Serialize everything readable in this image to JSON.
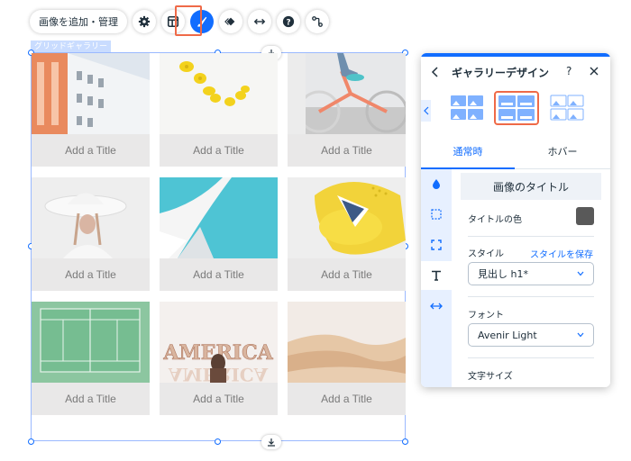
{
  "toolbar": {
    "add_manage_label": "画像を追加・管理",
    "icons": [
      "gear-icon",
      "layout-icon",
      "design-brush-icon",
      "animation-icon",
      "stretch-icon",
      "help-icon",
      "connect-icon"
    ]
  },
  "gallery": {
    "tag_label": "グリッドギャラリー",
    "items": [
      {
        "title": "Add a Title",
        "image": "white-building-facade"
      },
      {
        "title": "Add a Title",
        "image": "lemons-on-white"
      },
      {
        "title": "Add a Title",
        "image": "bicycle-sneakers"
      },
      {
        "title": "Add a Title",
        "image": "woman-in-white-hat"
      },
      {
        "title": "Add a Title",
        "image": "white-architecture-blue-sky"
      },
      {
        "title": "Add a Title",
        "image": "yellow-chair-with-hat"
      },
      {
        "title": "Add a Title",
        "image": "green-tennis-court"
      },
      {
        "title": "Add a Title",
        "image": "america-sign-woman"
      },
      {
        "title": "Add a Title",
        "image": "desert-dunes"
      }
    ]
  },
  "panel": {
    "title": "ギャラリーデザイン",
    "help_label": "?",
    "tabs": [
      "通常時",
      "ホバー"
    ],
    "active_tab": "通常時",
    "vertical_nav": [
      "droplet-icon",
      "border-icon",
      "corners-icon",
      "text-icon",
      "spacing-icon"
    ],
    "active_nav": "text-icon",
    "section_title": "画像のタイトル",
    "title_color_label": "タイトルの色",
    "title_color": "#595959",
    "style_label": "スタイル",
    "save_style_link": "スタイルを保存",
    "style_value": "見出し h1*",
    "font_label": "フォント",
    "font_value": "Avenir Light",
    "text_size_label": "文字サイズ"
  },
  "colors": {
    "accent": "#116dff",
    "highlight": "#ef6a48",
    "selection": "#9ab9ff"
  }
}
